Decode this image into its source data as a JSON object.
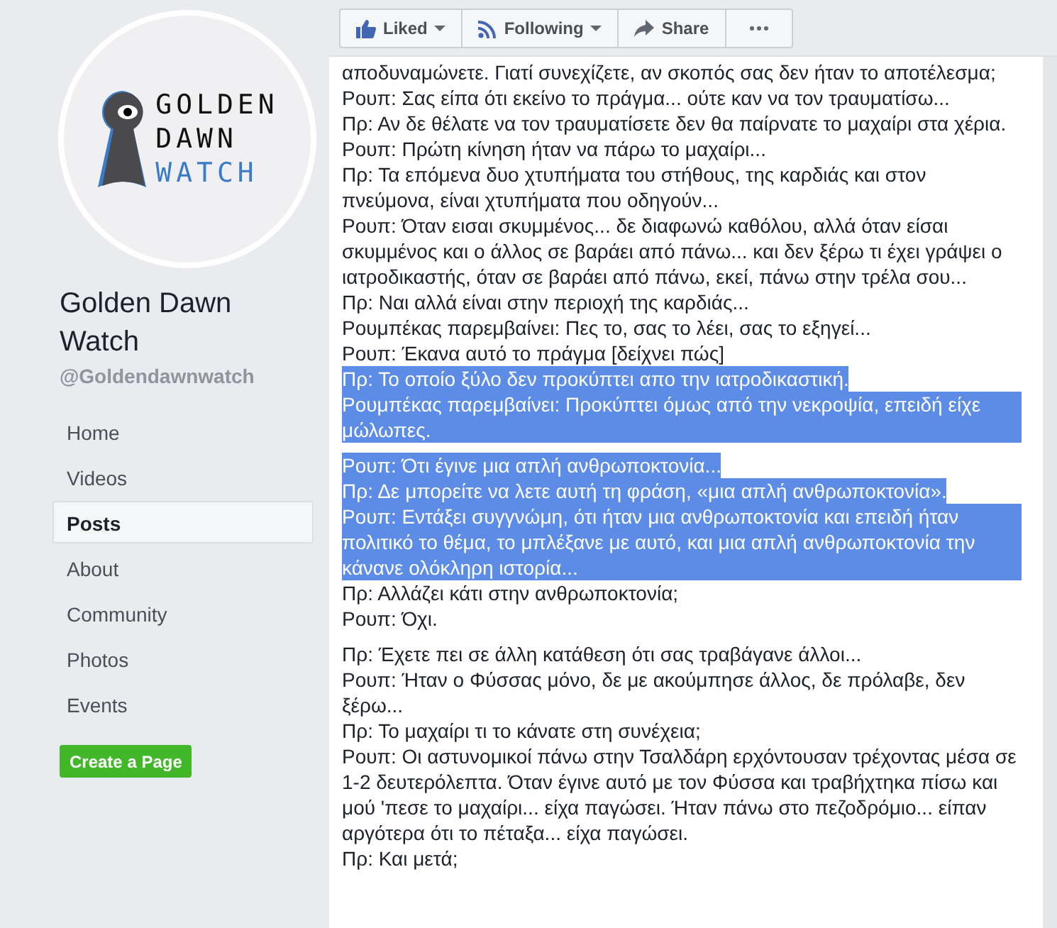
{
  "page": {
    "logo_lines": [
      "GOLDEN",
      "DAWN",
      "WATCH"
    ],
    "name": "Golden Dawn Watch",
    "handle": "@Goldendawnwatch"
  },
  "nav": [
    {
      "label": "Home",
      "selected": false
    },
    {
      "label": "Videos",
      "selected": false
    },
    {
      "label": "Posts",
      "selected": true
    },
    {
      "label": "About",
      "selected": false
    },
    {
      "label": "Community",
      "selected": false
    },
    {
      "label": "Photos",
      "selected": false
    },
    {
      "label": "Events",
      "selected": false
    }
  ],
  "create_button": "Create a Page",
  "actions": [
    {
      "kind": "like",
      "label": "Liked",
      "dropdown": true
    },
    {
      "kind": "follow",
      "label": "Following",
      "dropdown": true
    },
    {
      "kind": "share",
      "label": "Share",
      "dropdown": false
    },
    {
      "kind": "more",
      "dropdown": false
    }
  ],
  "post": {
    "paragraphs": [
      [
        {
          "text": "αποδυναμώνετε. Γιατί συνεχίζετε, αν σκοπός σας δεν ήταν το αποτέλεσμα;",
          "selected": false
        },
        {
          "text": "Ρουπ: Σας είπα ότι εκείνο το πράγμα... ούτε καν να τον τραυματίσω...",
          "selected": false
        },
        {
          "text": "Πρ: Αν δε θέλατε να τον τραυματίσετε δεν θα παίρνατε το μαχαίρι στα χέρια.",
          "selected": false
        },
        {
          "text": "Ρουπ: Πρώτη κίνηση ήταν να πάρω το μαχαίρι...",
          "selected": false
        },
        {
          "text": "Πρ: Τα επόμενα δυο χτυπήματα του στήθους, της καρδιάς και στον πνεύμονα, είναι χτυπήματα που οδηγούν...",
          "selected": false
        },
        {
          "text": "Ρουπ: Όταν εισαι σκυμμένος... δε διαφωνώ καθόλου, αλλά όταν είσαι σκυμμένος και ο άλλος σε βαράει από πάνω... και δεν ξέρω τι έχει γράψει ο ιατροδικαστής, όταν σε βαράει από πάνω, εκεί, πάνω στην τρέλα σου...",
          "selected": false
        },
        {
          "text": "Πρ: Ναι αλλά είναι στην περιοχή της καρδιάς...",
          "selected": false
        },
        {
          "text": "Ρουμπέκας παρεμβαίνει: Πες το, σας το λέει, σας το εξηγεί...",
          "selected": false
        },
        {
          "text": "Ρουπ: Έκανα αυτό το πράγμα [δείχνει πώς]",
          "selected": false
        },
        {
          "text": "Πρ: Το οποίο ξύλο δεν προκύπτει απο την ιατροδικαστική.",
          "selected": true
        },
        {
          "text": "Ρουμπέκας παρεμβαίνει: Προκύπτει όμως από την νεκροψία, επειδή είχε μώλωπες.",
          "selected": true
        }
      ],
      [
        {
          "text": "Ρουπ: Ότι έγινε μια απλή ανθρωποκτονία...",
          "selected": true
        },
        {
          "text": "Πρ: Δε μπορείτε να λετε αυτή τη φράση, «μια απλή ανθρωποκτονία».",
          "selected": true
        },
        {
          "text": "Ρουπ: Εντάξει συγγνώμη, ότι ήταν μια ανθρωποκτονία και επειδή ήταν πολιτικό το θέμα, το μπλέξανε με αυτό, και μια απλή ανθρωποκτονία την κάνανε ολόκληρη ιστορία...",
          "selected": true
        },
        {
          "text": "Πρ: Αλλάζει κάτι στην ανθρωποκτονία;",
          "selected": false
        },
        {
          "text": "Ρουπ: Όχι.",
          "selected": false
        }
      ],
      [
        {
          "text": "Πρ: Έχετε πει σε άλλη κατάθεση ότι σας τραβάγανε άλλοι...",
          "selected": false
        },
        {
          "text": "Ρουπ: Ήταν ο Φύσσας μόνο, δε με ακούμπησε άλλος, δε πρόλαβε, δεν ξέρω...",
          "selected": false
        },
        {
          "text": "Πρ: Το μαχαίρι τι το κάνατε στη συνέχεια;",
          "selected": false
        },
        {
          "text": "Ρουπ: Οι αστυνομικοί πάνω στην Τσαλδάρη ερχόντουσαν τρέχοντας μέσα σε 1-2 δευτερόλεπτα. Όταν έγινε αυτό με τον Φύσσα και τραβήχτηκα πίσω και μού 'πεσε το μαχαίρι... είχα παγώσει. Ήταν πάνω στο πεζοδρόμιο... είπαν αργότερα ότι το πέταξα... είχα παγώσει.",
          "selected": false
        },
        {
          "text": "Πρ: Και μετά;",
          "selected": false
        }
      ]
    ]
  }
}
